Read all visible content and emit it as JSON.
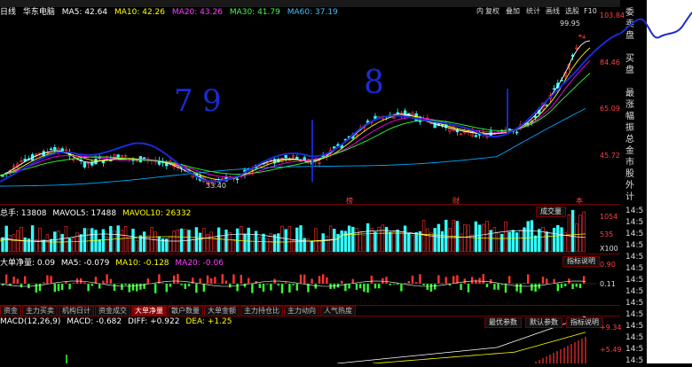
{
  "header": {
    "prefix": "日线",
    "stock_name": "华东电脑",
    "ma5": "MA5: 42.64",
    "ma10": "MA10: 42.26",
    "ma20": "MA20: 43.26",
    "ma30": "MA30: 41.79",
    "ma60": "MA60: 37.19"
  },
  "top_buttons": {
    "b1": "内",
    "b2": "复权",
    "b3": "叠加",
    "b4": "统计",
    "b5": "画线",
    "b6": "选股",
    "b7": "F10"
  },
  "price_axis": {
    "p1": "103.84",
    "p2": "84.46",
    "p3": "65.09",
    "p4": "45.72"
  },
  "price_marks": {
    "high": "99.95",
    "low": "33.40",
    "m1": "榜",
    "m2": "财",
    "m3": "本"
  },
  "volume": {
    "label": "总手: 13808",
    "mavol5": "MAVOL5: 17488",
    "mavol10": "MAVOL10: 26332",
    "button": "成交量",
    "axis_top": "1054",
    "axis_mid": "535",
    "axis_unit": "X100"
  },
  "netflow": {
    "label": "大单净量: 0.09",
    "ma5": "MA5: -0.079",
    "ma10": "MA10: -0.128",
    "ma20": "MA20: -0.06",
    "button": "指标说明",
    "axis_top": "0.90",
    "axis_mid": "0.11"
  },
  "tabs": [
    "资金",
    "主力买卖",
    "机构日计",
    "资金成交",
    "大单净量",
    "散户数量",
    "大单金额",
    "主力持仓比",
    "主力动向",
    "人气热度"
  ],
  "tabs_active": 4,
  "macd": {
    "label": "MACD(12,26,9)",
    "macd_val": "MACD: -0.682",
    "diff": "DIFF: +0.922",
    "dea": "DEA: +1.25",
    "btn_opt": "最优参数",
    "btn_def": "默认参数",
    "btn_help": "指标说明",
    "axis_top": "+9.34",
    "axis_mid": "+5.49"
  },
  "right_panel": [
    "委",
    "卖",
    "盘",
    "",
    "买",
    "盘",
    "",
    "最",
    "涨",
    "幅",
    "振",
    "总",
    "金",
    "市",
    "股",
    "外",
    "计"
  ],
  "right_times": [
    "14:5",
    "14:5",
    "14:5",
    "14:5",
    "14:5",
    "14:5",
    "14:5",
    "14:5",
    "14:5",
    "14:5",
    "14:5",
    "14:5",
    "14:5",
    "14:5"
  ],
  "annotations": {
    "a1": "7",
    "a2": "9",
    "a3": "8"
  },
  "colors": {
    "up": "#ff3333",
    "down": "#33ffff",
    "green": "#33ff33",
    "ma5": "#ffffff",
    "ma10": "#ffff00",
    "ma20": "#ff00ff",
    "ma30": "#33ff33",
    "ma60": "#00aaff",
    "pen": "#1a2bd6"
  }
}
